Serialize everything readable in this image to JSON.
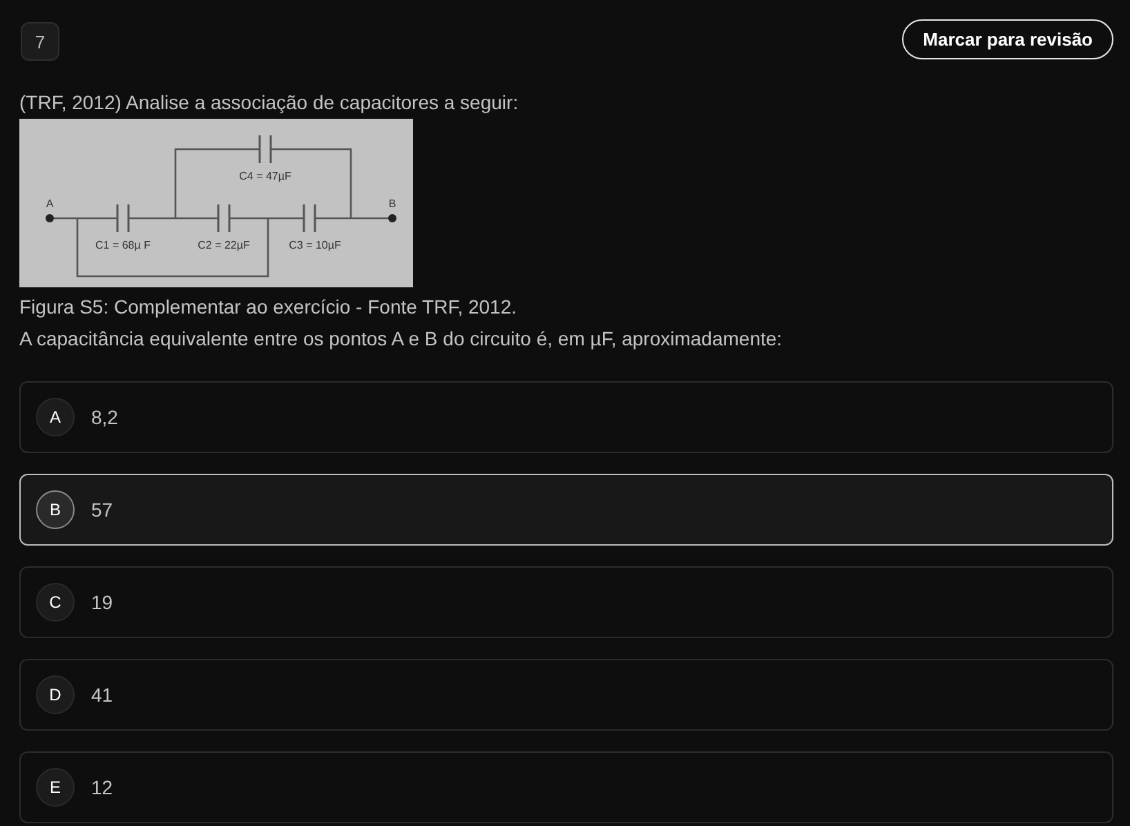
{
  "question_number": "7",
  "review_button": "Marcar para revisão",
  "statement": "(TRF, 2012) Analise a associação de capacitores a seguir:",
  "figure": {
    "terminals": [
      "A",
      "B"
    ],
    "capacitors": [
      {
        "label": "C1 = 68µ F"
      },
      {
        "label": "C2 = 22µF"
      },
      {
        "label": "C3 = 10µF"
      },
      {
        "label": "C4 = 47µF"
      }
    ]
  },
  "caption": "Figura S5: Complementar ao exercício - Fonte TRF, 2012.",
  "prompt": "A capacitância equivalente entre os pontos A e B do circuito é, em µF, aproximadamente:",
  "options": [
    {
      "letter": "A",
      "text": "8,2",
      "selected": false
    },
    {
      "letter": "B",
      "text": "57",
      "selected": true
    },
    {
      "letter": "C",
      "text": "19",
      "selected": false
    },
    {
      "letter": "D",
      "text": "41",
      "selected": false
    },
    {
      "letter": "E",
      "text": "12",
      "selected": false
    }
  ]
}
